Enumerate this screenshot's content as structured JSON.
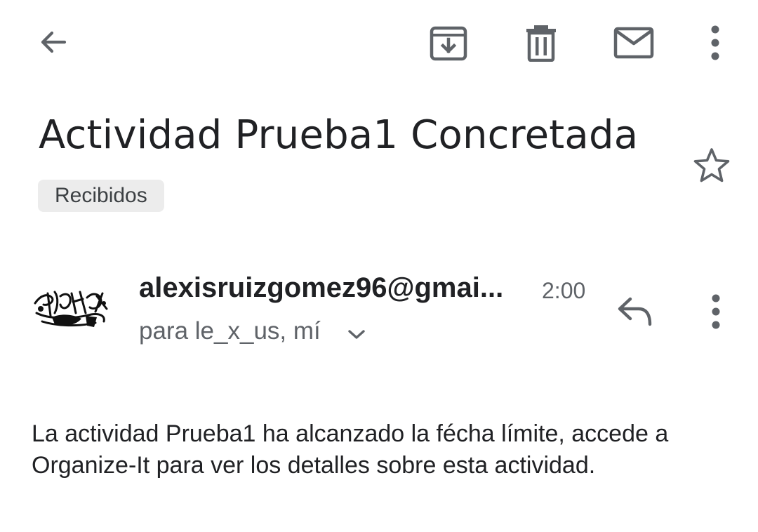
{
  "toolbar": {
    "back_icon": "arrow-back-icon",
    "archive_icon": "archive-icon",
    "delete_icon": "trash-icon",
    "mark_unread_icon": "mail-icon",
    "more_icon": "more-vert-icon"
  },
  "email": {
    "subject": "Actividad Prueba1 Concretada",
    "label": "Recibidos",
    "starred": false,
    "sender": "alexisruizgomez96@gmai...",
    "time": "2:00",
    "recipients": "para le_x_us, mí",
    "body": "La actividad Prueba1 ha alcanzado la fécha límite, accede a Organize-It para ver los detalles sobre esta actividad."
  },
  "colors": {
    "icon": "#5f6368",
    "chip_bg": "#ececec",
    "text": "#202124",
    "secondary_text": "#5f6368"
  }
}
